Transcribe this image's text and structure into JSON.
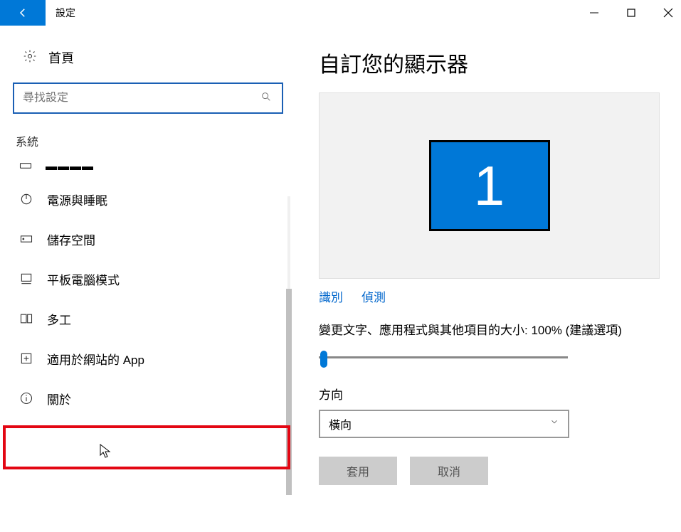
{
  "window": {
    "title": "設定"
  },
  "sidebar": {
    "home": "首頁",
    "search_placeholder": "尋找設定",
    "section": "系統",
    "items": [
      {
        "label": "電源與睡眠"
      },
      {
        "label": "儲存空間"
      },
      {
        "label": "平板電腦模式"
      },
      {
        "label": "多工"
      },
      {
        "label": "適用於網站的 App"
      },
      {
        "label": "關於"
      }
    ]
  },
  "content": {
    "title": "自訂您的顯示器",
    "monitor_number": "1",
    "link_identify": "識別",
    "link_detect": "偵測",
    "scale_text": "變更文字、應用程式與其他項目的大小: 100% (建議選項)",
    "orientation_label": "方向",
    "orientation_value": "橫向",
    "apply": "套用",
    "cancel": "取消"
  }
}
